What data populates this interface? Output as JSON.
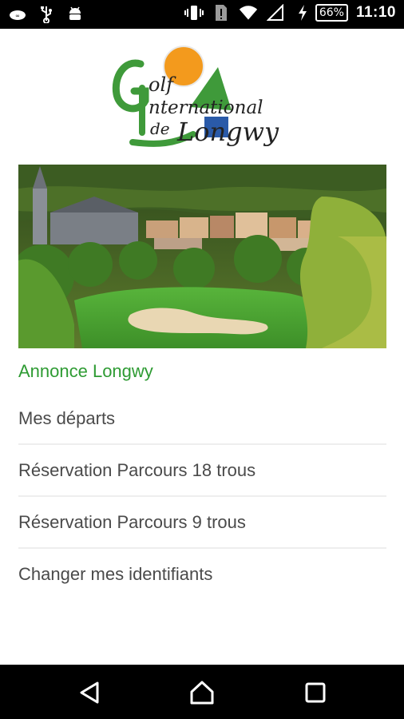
{
  "status_bar": {
    "left_icons": [
      "cloud-sync-icon",
      "usb-icon",
      "android-icon"
    ],
    "right_icons": [
      "vibrate-icon",
      "sim-alert-icon",
      "wifi-icon",
      "signal-icon",
      "charging-icon"
    ],
    "battery": "66%",
    "time": "11:10"
  },
  "logo": {
    "line1": "olf",
    "line2": "nternational",
    "line3_small": "de",
    "line3": "Longwy",
    "colors": {
      "green": "#3f9a3a",
      "orange": "#f39a1d",
      "blue": "#2a5aa8"
    }
  },
  "hero": {
    "icon": "golf-course-photo"
  },
  "menu": {
    "annonce": "Annonce Longwy",
    "items": [
      {
        "label": "Mes départs"
      },
      {
        "label": "Réservation Parcours 18 trous"
      },
      {
        "label": "Réservation Parcours 9 trous"
      },
      {
        "label": "Changer mes identifiants"
      }
    ]
  },
  "nav": {
    "back_icon": "back-icon",
    "home_icon": "home-icon",
    "recents_icon": "recents-icon"
  }
}
